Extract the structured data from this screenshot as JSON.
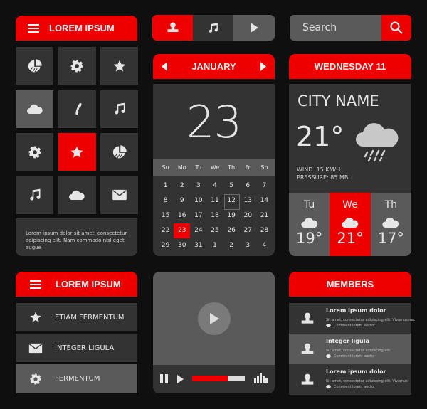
{
  "colors": {
    "accent": "#ee0000",
    "panel_dark": "#333333",
    "panel_mid": "#5a5a5a",
    "background": "#0f0f0f",
    "text": "#e6e6e6"
  },
  "tile_menu": {
    "title": "LOREM IPSUM",
    "tiles": [
      {
        "icon": "pie-chart-icon",
        "active": false
      },
      {
        "icon": "gear-icon",
        "active": false
      },
      {
        "icon": "star-icon",
        "active": false
      },
      {
        "icon": "cloud-icon",
        "active": false,
        "highlight": true
      },
      {
        "icon": "phone-icon",
        "active": false
      },
      {
        "icon": "music-icon",
        "active": false
      },
      {
        "icon": "gear-icon",
        "active": false
      },
      {
        "icon": "star-icon",
        "active": true
      },
      {
        "icon": "pie-chart-icon",
        "active": false
      },
      {
        "icon": "music-icon",
        "active": false
      },
      {
        "icon": "cloud-icon",
        "active": false
      },
      {
        "icon": "mail-icon",
        "active": false
      }
    ],
    "description": "Lorem ipsum dolor sit amet, consectetur adipiscing elit. Nam commodo nisl eget augue"
  },
  "segmented": {
    "items": [
      "user-icon",
      "music-icon",
      "play-icon"
    ],
    "active_index": 0
  },
  "search": {
    "placeholder": "Search",
    "button_icon": "search-icon"
  },
  "calendar": {
    "month": "JANUARY",
    "big_day": "23",
    "weekdays": [
      "Su",
      "Mo",
      "Tu",
      "We",
      "Th",
      "Fr",
      "So"
    ],
    "days": [
      "1",
      "2",
      "3",
      "4",
      "5",
      "6",
      "7",
      "8",
      "9",
      "10",
      "11",
      "12",
      "13",
      "14",
      "15",
      "16",
      "17",
      "18",
      "19",
      "20",
      "21",
      "22",
      "23",
      "24",
      "25",
      "26",
      "27",
      "28",
      "29",
      "30",
      "31",
      "1",
      "2",
      "3",
      "4"
    ],
    "selected_day": "23",
    "outlined_day": "12"
  },
  "weather": {
    "header": "WEDNESDAY 11",
    "city": "CITY NAME",
    "temperature": "21°",
    "wind": "WIND: 15 KM/H",
    "pressure": "PRESSURE: 85 MB",
    "condition_icon": "rain-cloud-icon",
    "forecast": [
      {
        "day": "Tu",
        "temp": "19°",
        "icon": "cloud-icon",
        "active": false
      },
      {
        "day": "We",
        "temp": "21°",
        "icon": "cloud-icon",
        "active": true
      },
      {
        "day": "Th",
        "temp": "17°",
        "icon": "cloud-icon",
        "active": false
      }
    ]
  },
  "list_menu": {
    "title": "LOREM IPSUM",
    "items": [
      {
        "label": "ETIAM FERMENTUM",
        "icon": "star-icon"
      },
      {
        "label": "INTEGER LIGULA",
        "icon": "mail-icon"
      },
      {
        "label": "FERMENTUM",
        "icon": "gear-icon",
        "active": true
      }
    ]
  },
  "video": {
    "progress": 0.68
  },
  "members": {
    "title": "MEMBERS",
    "items": [
      {
        "name": "Lorem ipsum dolor",
        "desc": "Sit amet, consectetur adipiscing elit. Vivamus nec",
        "comment": "Comment lorem auctor"
      },
      {
        "name": "Integer ligula",
        "desc": "Sit amet, consectetur adipiscing elit.",
        "comment": "Comment lorem auctor",
        "active": true
      },
      {
        "name": "Lorem ipsum dolor",
        "desc": "Sit amet, consectetur adipiscing elit. Vivamus",
        "comment": "Comment lorem auctor"
      }
    ]
  }
}
